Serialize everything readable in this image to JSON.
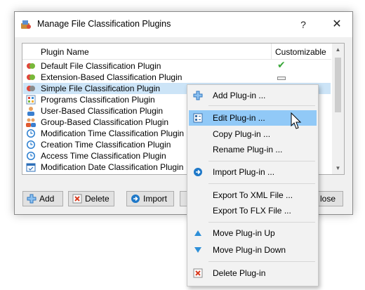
{
  "dialog": {
    "title": "Manage File Classification Plugins",
    "help_glyph": "?",
    "close_glyph": "✕"
  },
  "list": {
    "columns": {
      "name": "Plugin Name",
      "customizable": "Customizable"
    },
    "rows": [
      {
        "label": "Default File Classification Plugin",
        "customizable": "check"
      },
      {
        "label": "Extension-Based Classification Plugin",
        "customizable": "dash"
      },
      {
        "label": "Simple File Classification Plugin",
        "customizable": "",
        "selected": true
      },
      {
        "label": "Programs Classification Plugin",
        "customizable": ""
      },
      {
        "label": "User-Based Classification Plugin",
        "customizable": ""
      },
      {
        "label": "Group-Based Classification Plugin",
        "customizable": ""
      },
      {
        "label": "Modification Time Classification Plugin",
        "customizable": ""
      },
      {
        "label": "Creation Time Classification Plugin",
        "customizable": ""
      },
      {
        "label": "Access Time Classification Plugin",
        "customizable": ""
      },
      {
        "label": "Modification Date Classification Plugin",
        "customizable": ""
      }
    ]
  },
  "buttons": {
    "add": "Add",
    "delete": "Delete",
    "import": "Import",
    "close_partial": "lose"
  },
  "context_menu": {
    "items": [
      {
        "label": "Add Plug-in ...",
        "icon": "plus-icon"
      },
      {
        "label": "Edit Plug-in ...",
        "icon": "edit-icon",
        "highlighted": true
      },
      {
        "label": "Copy Plug-in ...",
        "icon": ""
      },
      {
        "label": "Rename Plug-in ...",
        "icon": ""
      },
      {
        "label": "Import Plug-in ...",
        "icon": "import-arrow-icon"
      },
      {
        "label": "Export To XML File ...",
        "icon": ""
      },
      {
        "label": "Export To FLX File ...",
        "icon": ""
      },
      {
        "label": "Move Plug-in Up",
        "icon": "triangle-up-icon"
      },
      {
        "label": "Move Plug-in Down",
        "icon": "triangle-down-icon"
      },
      {
        "label": "Delete Plug-in",
        "icon": "delete-icon"
      }
    ]
  },
  "colors": {
    "selection": "#cce4f7",
    "menu_highlight": "#91c9f7",
    "accent_blue": "#1e78c8",
    "check_green": "#3aa73a",
    "delete_red": "#d83b1f"
  }
}
